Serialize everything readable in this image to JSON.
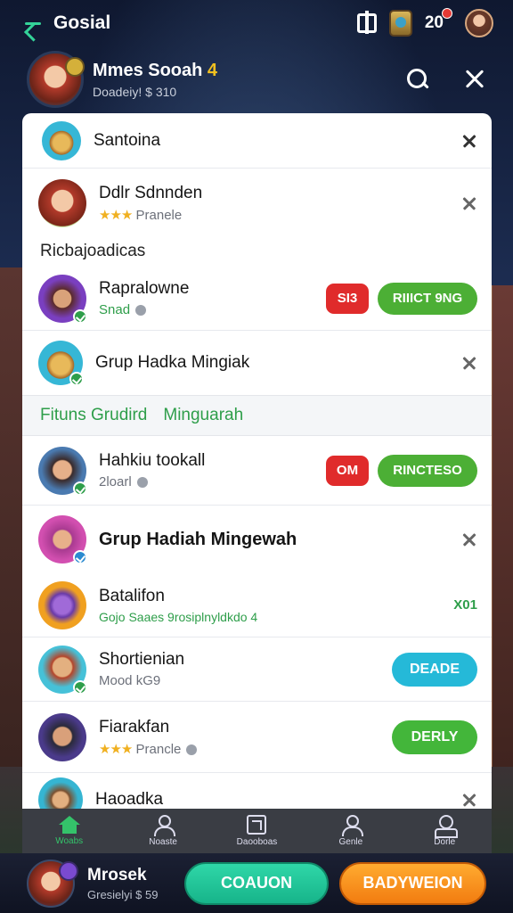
{
  "topbar": {
    "title": "Gosial",
    "notification_count": "20"
  },
  "profile": {
    "name": "Mmes Sooah",
    "badge": "4",
    "subtitle": "Doadeiy! $ 310"
  },
  "panel": {
    "row1": {
      "title": "Santoina"
    },
    "row2": {
      "title": "Ddlr Sdnnden",
      "stars": "★★★",
      "meta": "Pranele"
    },
    "section1": {
      "label": "Ricbajoadicas"
    },
    "row3": {
      "title": "Rapralowne",
      "meta": "Snad",
      "badge": "SI3",
      "action": "RIIICT 9NG"
    },
    "row4": {
      "title": "Grup Hadka Mingiak"
    },
    "section2": {
      "label_a": "Fituns Grudird",
      "label_b": "Minguarah"
    },
    "row5": {
      "title": "Hahkiu tookall",
      "meta": "2loarl",
      "badge": "OM",
      "action": "RINCTESO"
    },
    "row6": {
      "title": "Grup  Hadiah Mingewah"
    },
    "row7": {
      "title": "Batalifon",
      "meta": "Gojo  Saaes 9rosiplnyldkdo 4",
      "count": "X01"
    },
    "row8": {
      "title": "Shortienian",
      "meta": "Mood kG9",
      "action": "DEADE"
    },
    "row9": {
      "title": "Fiarakfan",
      "stars": "★★★",
      "meta": "Prancle",
      "action": "DERLY"
    },
    "row10": {
      "title": "Haoadka"
    }
  },
  "nav": {
    "items": [
      {
        "label": "Woabs",
        "icon": "home-icon"
      },
      {
        "label": "Noaste",
        "icon": "user-icon"
      },
      {
        "label": "Daooboas",
        "icon": "box-icon"
      },
      {
        "label": "Genle",
        "icon": "user-icon"
      },
      {
        "label": "Dorle",
        "icon": "pin-icon"
      }
    ]
  },
  "footer": {
    "name": "Mrosek",
    "subtitle": "Gresielyi $ 59",
    "btn_primary": "COAUON",
    "btn_secondary": "BADYWEION"
  },
  "colors": {
    "accent_green": "#4caf35",
    "accent_teal": "#17b48a",
    "accent_orange": "#f27c10",
    "alert_red": "#e02b2b",
    "cyan": "#25b9d8"
  }
}
